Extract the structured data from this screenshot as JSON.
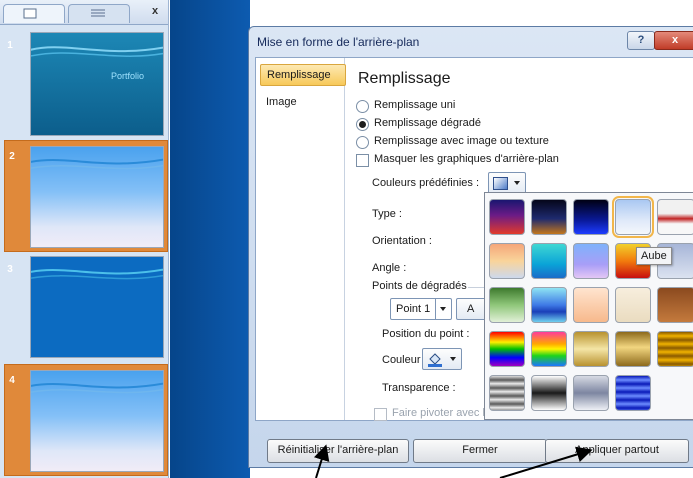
{
  "pane": {
    "close": "x",
    "slides": [
      {
        "num": "1",
        "text": "Portfolio"
      },
      {
        "num": "2",
        "text": ""
      },
      {
        "num": "3",
        "text": ""
      },
      {
        "num": "4",
        "text": ""
      }
    ]
  },
  "dialog": {
    "title": "Mise en forme de l'arrière-plan",
    "help": "?",
    "close": "x",
    "nav": {
      "fill": "Remplissage",
      "image": "Image"
    },
    "heading": "Remplissage",
    "options": {
      "solid": "Remplissage uni",
      "gradient": "Remplissage dégradé",
      "picture": "Remplissage avec image ou texture",
      "hide": "Masquer les graphiques d'arrière-plan"
    },
    "preset_label": "Couleurs prédéfinies :",
    "type_label": "Type :",
    "orientation_label": "Orientation :",
    "angle_label": "Angle :",
    "stops_label": "Points de dégradés",
    "stop_value": "Point 1",
    "add_partial": "A",
    "position_label": "Position du point :",
    "color_label": "Couleur :",
    "transparency_label": "Transparence :",
    "rotate": "Faire pivoter avec la forme",
    "buttons": {
      "reset": "Réinitialiser l'arrière-plan",
      "close": "Fermer",
      "apply_all": "Appliquer partout"
    }
  },
  "tooltip": "Aube",
  "colors": {
    "accent_orange": "#e0893a",
    "selection": "#f7c95a",
    "titlebar": "#c5d6ec"
  }
}
